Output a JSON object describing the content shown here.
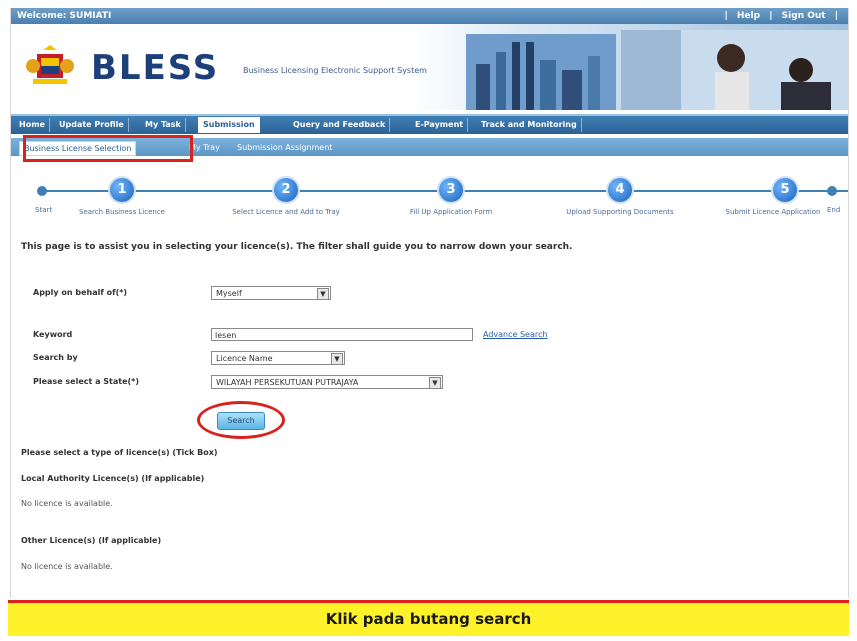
{
  "topbar": {
    "welcome": "Welcome: SUMIATI",
    "help": "Help",
    "sign_out": "Sign Out"
  },
  "banner": {
    "logo": "BLESS",
    "subtitle": "Business Licensing Electronic Support System"
  },
  "main_nav": [
    "Home",
    "Update Profile",
    "My Task",
    "Submission",
    "Query and Feedback",
    "E-Payment",
    "Track and Monitoring"
  ],
  "main_nav_active": "Submission",
  "sub_nav": [
    "Business License Selection",
    "My Tray",
    "Submission Assignment"
  ],
  "steps": {
    "start": "Start",
    "end": "End",
    "items": [
      {
        "num": "1",
        "label": "Search Business Licence"
      },
      {
        "num": "2",
        "label": "Select Licence and Add to Tray"
      },
      {
        "num": "3",
        "label": "Fill Up Application Form"
      },
      {
        "num": "4",
        "label": "Upload Supporting Documents"
      },
      {
        "num": "5",
        "label": "Submit Licence Application"
      }
    ]
  },
  "intro": "This page is to assist you in selecting your licence(s). The filter shall guide you to narrow down your search.",
  "form": {
    "apply_label": "Apply on behalf of(*)",
    "apply_value": "Myself",
    "keyword_label": "Keyword",
    "keyword_value": "lesen",
    "advance_search": "Advance Search",
    "search_by_label": "Search by",
    "search_by_value": "Licence Name",
    "state_label": "Please select a State(*)",
    "state_value": "WILAYAH PERSEKUTUAN PUTRAJAYA",
    "search_button": "Search"
  },
  "results": {
    "type_prompt": "Please select a type of licence(s) (Tick Box)",
    "local_heading": "Local Authority Licence(s) (If applicable)",
    "local_note": "No licence is available.",
    "other_heading": "Other Licence(s) (If applicable)",
    "other_note": "No licence is available."
  },
  "caption": "Klik pada butang search",
  "colors": {
    "nav_blue": "#2c6296",
    "highlight_red": "#d9221d",
    "caption_yellow": "#fff22a"
  }
}
